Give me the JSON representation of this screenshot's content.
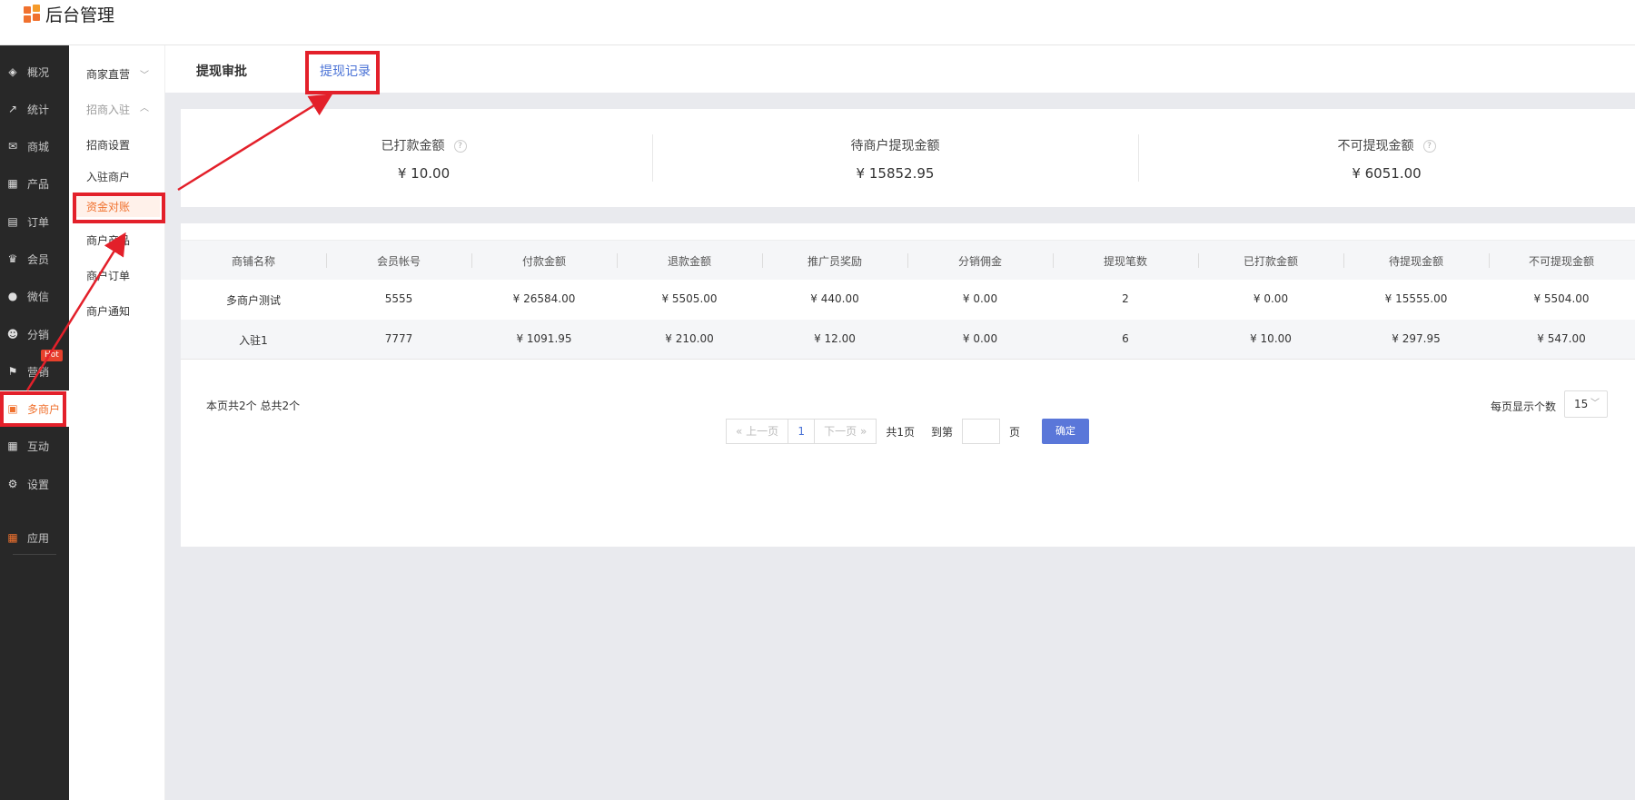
{
  "app": {
    "title": "后台管理"
  },
  "sidebar": {
    "items": [
      {
        "label": "概况",
        "icon": "layers-icon",
        "glyph": "◈"
      },
      {
        "label": "统计",
        "icon": "chart-icon",
        "glyph": "↗"
      },
      {
        "label": "商城",
        "icon": "mail-icon",
        "glyph": "✉"
      },
      {
        "label": "产品",
        "icon": "grid-icon",
        "glyph": "▦"
      },
      {
        "label": "订单",
        "icon": "clipboard-icon",
        "glyph": "▤"
      },
      {
        "label": "会员",
        "icon": "crown-icon",
        "glyph": "♛"
      },
      {
        "label": "微信",
        "icon": "chat-icon",
        "glyph": "●"
      },
      {
        "label": "分销",
        "icon": "user-icon",
        "glyph": "☻"
      },
      {
        "label": "营销",
        "icon": "flag-icon",
        "glyph": "⚑"
      },
      {
        "label": "多商户",
        "icon": "store-icon",
        "glyph": "▣"
      },
      {
        "label": "互动",
        "icon": "apps-icon",
        "glyph": "▦"
      },
      {
        "label": "设置",
        "icon": "gear-icon",
        "glyph": "⚙"
      },
      {
        "label": "应用",
        "icon": "app-grid-icon",
        "glyph": "▦"
      }
    ],
    "hot_badge": "Hot"
  },
  "subnav": {
    "group1": "商家直营",
    "group2": "招商入驻",
    "items": [
      "招商设置",
      "入驻商户",
      "资金对账",
      "商户产品",
      "商户订单",
      "商户通知"
    ]
  },
  "tabs": [
    "提现审批",
    "提现记录"
  ],
  "summary": [
    {
      "label": "已打款金额",
      "value": "¥ 10.00",
      "help": "?"
    },
    {
      "label": "待商户提现金额",
      "value": "¥ 15852.95"
    },
    {
      "label": "不可提现金额",
      "value": "¥ 6051.00",
      "help": "?"
    }
  ],
  "table": {
    "headers": [
      "商铺名称",
      "会员帐号",
      "付款金额",
      "退款金额",
      "推广员奖励",
      "分销佣金",
      "提现笔数",
      "已打款金额",
      "待提现金额",
      "不可提现金额"
    ],
    "rows": [
      [
        "多商户测试",
        "5555",
        "¥ 26584.00",
        "¥ 5505.00",
        "¥ 440.00",
        "¥ 0.00",
        "2",
        "¥ 0.00",
        "¥ 15555.00",
        "¥ 5504.00"
      ],
      [
        "入驻1",
        "7777",
        "¥ 1091.95",
        "¥ 210.00",
        "¥ 12.00",
        "¥ 0.00",
        "6",
        "¥ 10.00",
        "¥ 297.95",
        "¥ 547.00"
      ]
    ]
  },
  "pagination": {
    "page_info": "本页共2个   总共2个",
    "prev": "« 上一页",
    "current": "1",
    "next": "下一页 »",
    "total_pages": "共1页",
    "goto": "到第",
    "page_unit": "页",
    "confirm": "确定",
    "per_page_label": "每页显示个数",
    "per_page_value": "15"
  },
  "colors": {
    "accent": "#f0712e",
    "link": "#4a72d6",
    "annotation": "#e3202a"
  }
}
